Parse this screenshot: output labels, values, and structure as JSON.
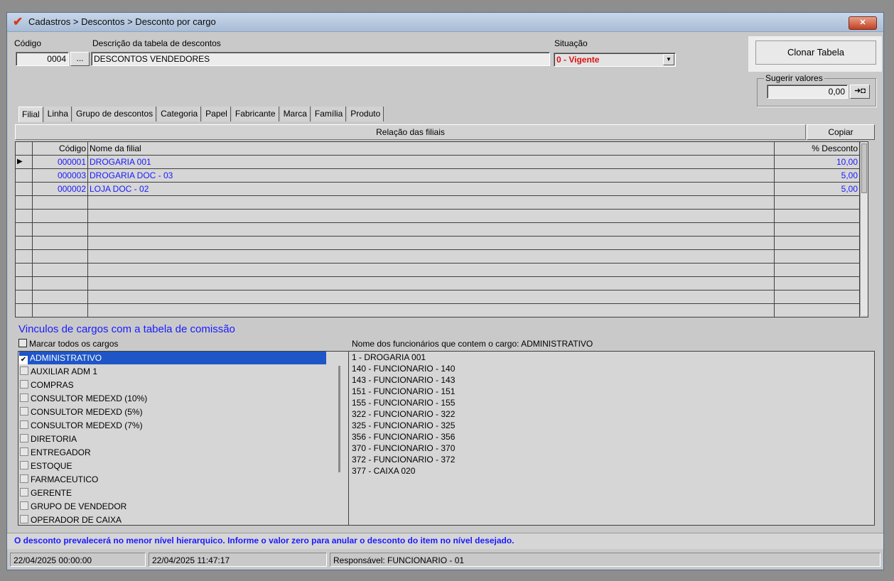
{
  "window": {
    "title": "Cadastros > Descontos > Desconto por cargo",
    "close_icon": "close-icon"
  },
  "header": {
    "codigo_label": "Código",
    "codigo_value": "0004",
    "lookup_label": "...",
    "descricao_label": "Descrição da tabela de descontos",
    "descricao_value": "DESCONTOS VENDEDORES",
    "situacao_label": "Situação",
    "situacao_value": "0 - Vigente",
    "clonar_label": "Clonar Tabela",
    "sugerir_label": "Sugerir valores",
    "sugerir_value": "0,00",
    "sugerir_btn": "➜◘"
  },
  "tabs": [
    "Filial",
    "Linha",
    "Grupo de descontos",
    "Categoria",
    "Papel",
    "Fabricante",
    "Marca",
    "Família",
    "Produto"
  ],
  "filiais": {
    "section_title": "Relação das filiais",
    "copiar_label": "Copiar",
    "columns": [
      "Código",
      "Nome da filial",
      "% Desconto"
    ],
    "rows": [
      {
        "codigo": "000001",
        "nome": "DROGARIA 001",
        "desconto": "10,00"
      },
      {
        "codigo": "000003",
        "nome": "DROGARIA DOC - 03",
        "desconto": "5,00"
      },
      {
        "codigo": "000002",
        "nome": "LOJA  DOC - 02",
        "desconto": "5,00"
      }
    ]
  },
  "vinculos": {
    "title": "Vinculos de cargos com a tabela de comissão",
    "marcar_todos": "Marcar todos os cargos",
    "cargos": [
      {
        "name": "ADMINISTRATIVO",
        "checked": true
      },
      {
        "name": "AUXILIAR ADM 1",
        "checked": false
      },
      {
        "name": "COMPRAS",
        "checked": false
      },
      {
        "name": "CONSULTOR MEDEXD (10%)",
        "checked": false
      },
      {
        "name": "CONSULTOR MEDEXD (5%)",
        "checked": false
      },
      {
        "name": "CONSULTOR MEDEXD (7%)",
        "checked": false
      },
      {
        "name": "DIRETORIA",
        "checked": false
      },
      {
        "name": "ENTREGADOR",
        "checked": false
      },
      {
        "name": "ESTOQUE",
        "checked": false
      },
      {
        "name": "FARMACEUTICO",
        "checked": false
      },
      {
        "name": "GERENTE",
        "checked": false
      },
      {
        "name": "GRUPO DE VENDEDOR",
        "checked": false
      },
      {
        "name": "OPERADOR DE CAIXA",
        "checked": false
      }
    ],
    "funcionarios_title": "Nome dos funcionários que contem o cargo: ADMINISTRATIVO",
    "funcionarios": [
      "1 - DROGARIA 001",
      "140 - FUNCIONARIO - 140",
      "143 - FUNCIONARIO - 143",
      "151 - FUNCIONARIO - 151",
      "155 - FUNCIONARIO - 155",
      "322 - FUNCIONARIO - 322",
      "325 - FUNCIONARIO - 325",
      "356 - FUNCIONARIO - 356",
      "370 - FUNCIONARIO - 370",
      "372 - FUNCIONARIO - 372",
      "377 - CAIXA 020"
    ]
  },
  "status_message": "O desconto prevalecerá no menor nível hierarquico. Informe o valor zero para anular o desconto do item no nível desejado.",
  "footer": {
    "date_created": "22/04/2025 00:00:00",
    "date_updated": "22/04/2025 11:47:17",
    "responsavel": "Responsável: FUNCIONARIO - 01"
  },
  "colors": {
    "accent_blue": "#1a1aff",
    "situacao_red": "#e01010",
    "selection": "#1e56c8"
  }
}
